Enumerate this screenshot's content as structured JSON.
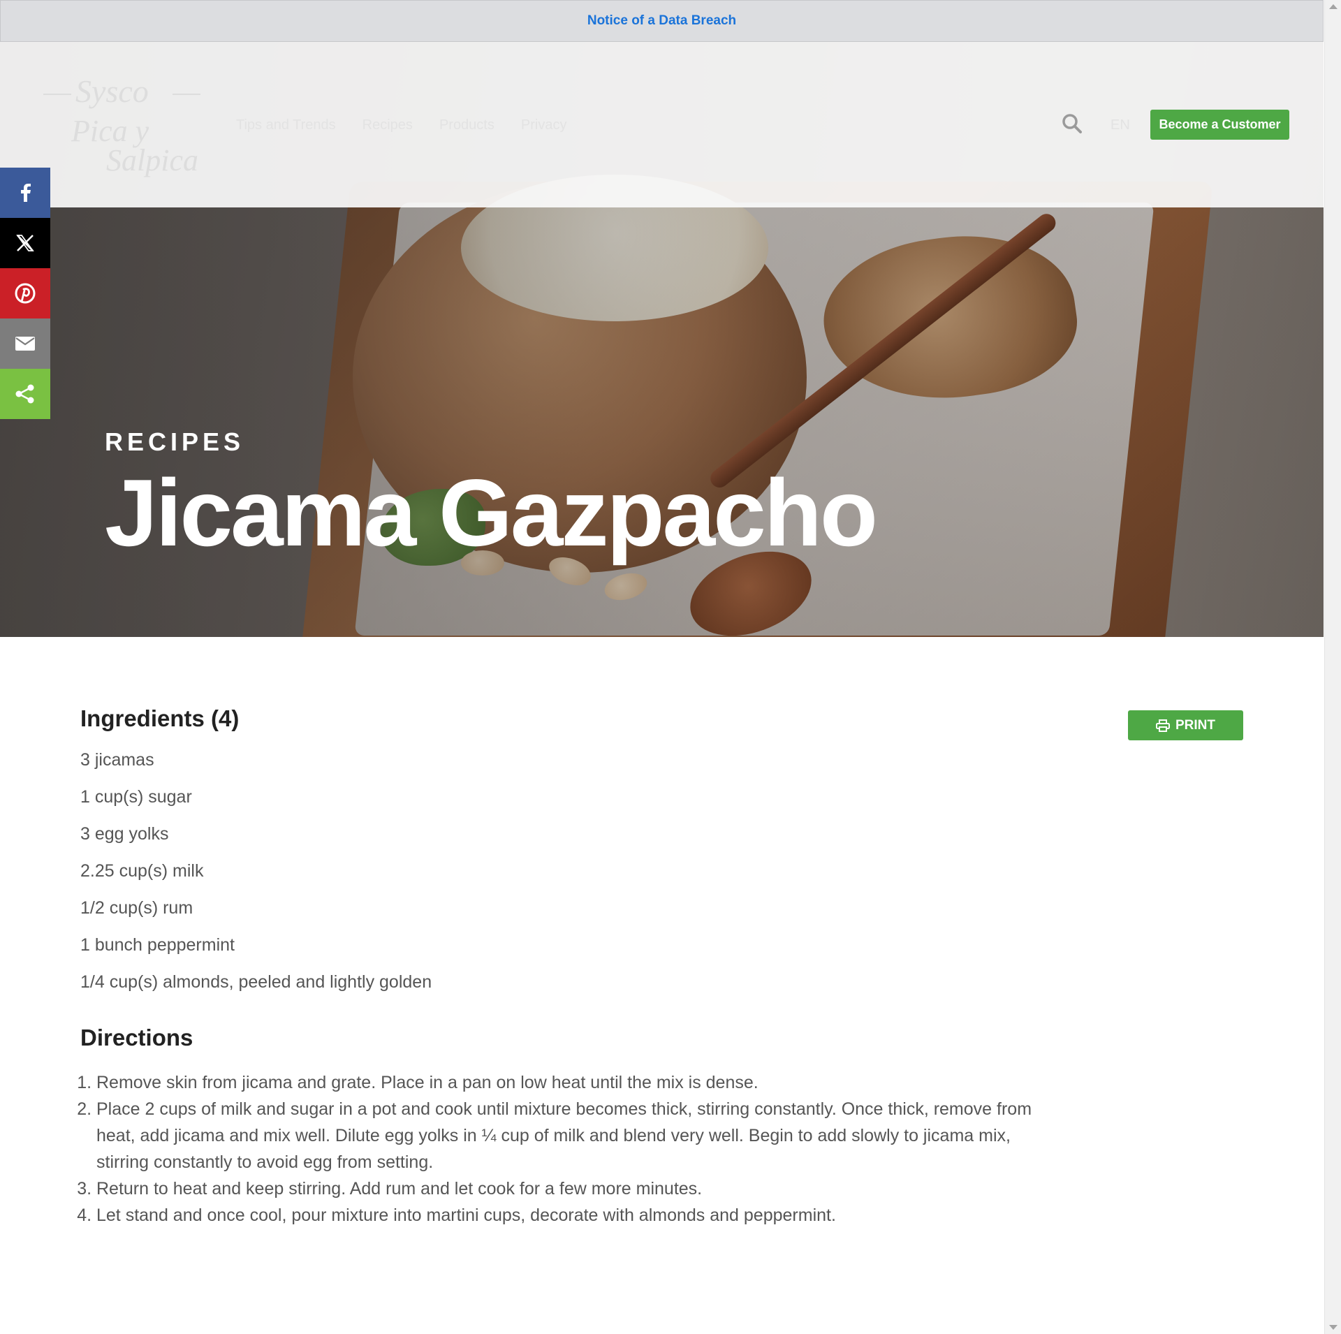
{
  "notice": {
    "link_text": "Notice of a Data Breach"
  },
  "header": {
    "logo_lines": [
      "Sysco",
      "Pica y",
      "Salpica"
    ],
    "nav": [
      "Tips and Trends",
      "Recipes",
      "Products",
      "Privacy"
    ],
    "language": "EN",
    "cta_label": "Become a Customer",
    "cta_color": "#4ea845"
  },
  "share": {
    "buttons": [
      {
        "icon": "facebook-icon",
        "color": "#3b5a9a"
      },
      {
        "icon": "x-icon",
        "color": "#000000"
      },
      {
        "icon": "pinterest-icon",
        "color": "#cb2027"
      },
      {
        "icon": "email-icon",
        "color": "#7d7d7d"
      },
      {
        "icon": "share-icon",
        "color": "#7ac142"
      }
    ]
  },
  "hero": {
    "kicker": "RECIPES",
    "title": "Jicama Gazpacho"
  },
  "ingredients": {
    "heading": "Ingredients (4)",
    "print_label": "PRINT",
    "items": [
      "3 jicamas",
      "1 cup(s) sugar",
      "3 egg yolks",
      "2.25 cup(s) milk",
      "1/2 cup(s) rum",
      "1 bunch peppermint",
      "1/4 cup(s) almonds, peeled and lightly golden"
    ]
  },
  "directions": {
    "heading": "Directions",
    "steps": [
      "Remove skin from jicama and grate. Place in a pan on low heat until the mix is dense.",
      "Place 2 cups of milk and sugar in a pot and cook until mixture becomes thick, stirring constantly. Once thick, remove from heat, add jicama and mix well. Dilute egg yolks in ¼ cup of milk and blend very well. Begin to add slowly to jicama mix, stirring constantly to avoid egg from setting.",
      "Return to heat and keep stirring. Add rum and let cook for a few more minutes.",
      "Let stand and once cool, pour mixture into martini cups, decorate with almonds and peppermint."
    ]
  }
}
